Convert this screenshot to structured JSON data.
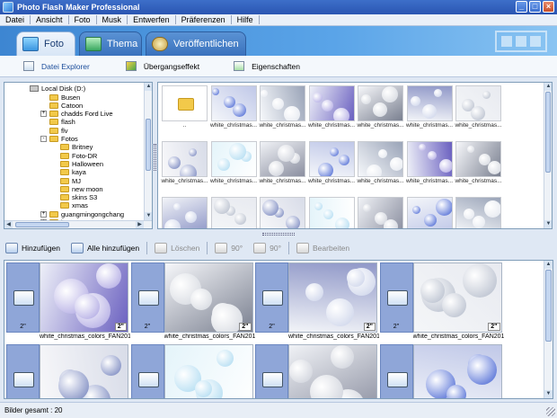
{
  "window": {
    "title": "Photo Flash Maker Professional"
  },
  "menu": [
    "Datei",
    "Ansicht",
    "Foto",
    "Musk",
    "Entwerfen",
    "Präferenzen",
    "Hilfe"
  ],
  "main_tabs": [
    {
      "label": "Foto",
      "active": true,
      "icon": "photo-icon"
    },
    {
      "label": "Thema",
      "active": false,
      "icon": "theme-icon"
    },
    {
      "label": "Veröffentlichen",
      "active": false,
      "icon": "publish-icon"
    }
  ],
  "sub_tabs": [
    {
      "label": "Datei Explorer",
      "active": true,
      "icon": "file-explorer-icon"
    },
    {
      "label": "Übergangseffekt",
      "active": false,
      "icon": "transition-icon"
    },
    {
      "label": "Eigenschaften",
      "active": false,
      "icon": "properties-icon"
    }
  ],
  "tree": {
    "drive": "Local Disk (D:)",
    "items": [
      {
        "label": "Busen",
        "level": 1,
        "expandable": false
      },
      {
        "label": "Catoon",
        "level": 1,
        "expandable": false
      },
      {
        "label": "chadds Ford Live",
        "level": 1,
        "expandable": true
      },
      {
        "label": "flash",
        "level": 1,
        "expandable": false
      },
      {
        "label": "flv",
        "level": 1,
        "expandable": false
      },
      {
        "label": "Fotos",
        "level": 1,
        "expandable": true,
        "expanded": true
      },
      {
        "label": "Britney",
        "level": 2,
        "expandable": false
      },
      {
        "label": "Foto-DR",
        "level": 2,
        "expandable": false
      },
      {
        "label": "Halloween",
        "level": 2,
        "expandable": false
      },
      {
        "label": "kaya",
        "level": 2,
        "expandable": false
      },
      {
        "label": "MJ",
        "level": 2,
        "expandable": false
      },
      {
        "label": "new moon",
        "level": 2,
        "expandable": false
      },
      {
        "label": "skins S3",
        "level": 2,
        "expandable": false
      },
      {
        "label": "xmas",
        "level": 2,
        "expandable": false
      },
      {
        "label": "guangmingongchang",
        "level": 1,
        "expandable": true
      },
      {
        "label": "kaya",
        "level": 1,
        "expandable": true
      }
    ]
  },
  "grid": {
    "parent_label": "..",
    "caption": "white_christmas...",
    "columns": 7,
    "rows": 3
  },
  "actions": [
    {
      "label": "Hinzufügen",
      "enabled": true,
      "icon": "add-icon"
    },
    {
      "label": "Alle hinzufügen",
      "enabled": true,
      "icon": "add-all-icon"
    },
    {
      "label": "Löschen",
      "enabled": false,
      "icon": "delete-icon"
    },
    {
      "label": "90°",
      "enabled": false,
      "icon": "rotate-left-icon"
    },
    {
      "label": "90°",
      "enabled": false,
      "icon": "rotate-right-icon"
    },
    {
      "label": "Bearbeiten",
      "enabled": false,
      "icon": "edit-icon"
    }
  ],
  "storyboard": {
    "transition_duration": "2\"",
    "photo_duration": "2\"",
    "caption": "white_christmas_colors_FAN201..."
  },
  "status": {
    "text": "Bilder gesamt : 20"
  },
  "colors": {
    "accent": "#3a72bd",
    "transition_bg": "#8fa6d8"
  }
}
